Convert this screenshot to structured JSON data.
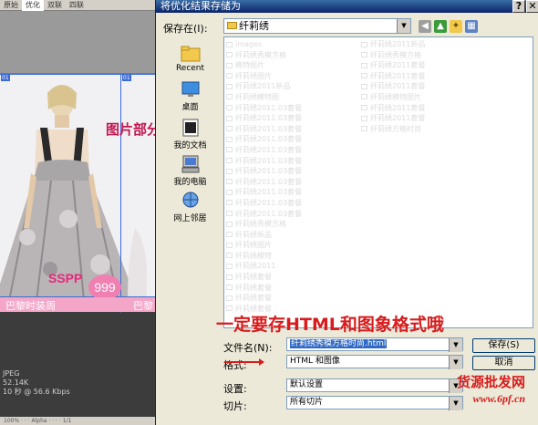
{
  "background_editor": {
    "tabs": [
      "原始",
      "优化",
      "双联",
      "四联"
    ],
    "slice_tags": [
      "01",
      "01"
    ],
    "promo_text": "图片部分",
    "brand": "SSPP",
    "badge": "999",
    "bar_text_left": "巴黎时装周",
    "bar_text_right": "巴黎",
    "status": [
      "JPEG",
      "52.14K",
      "10 秒 @ 56.6 Kbps"
    ],
    "bottom_bar": "100%  ·  ·  ·  Alpha  ·  ·  ·  ·  1/1"
  },
  "dialog": {
    "title": "将优化结果存储为",
    "title_buttons": [
      "?",
      "✕"
    ],
    "save_in_label": "保存在(I):",
    "current_folder": "纤莉绣",
    "places": [
      {
        "label": "Recent",
        "icon": "recent-folder-icon"
      },
      {
        "label": "桌面",
        "icon": "desktop-icon"
      },
      {
        "label": "我的文档",
        "icon": "my-documents-icon"
      },
      {
        "label": "我的电脑",
        "icon": "my-computer-icon"
      },
      {
        "label": "网上邻居",
        "icon": "network-places-icon"
      }
    ],
    "overlay_note": "一定要存HTML和图象格式哦",
    "filename_label": "文件名(N):",
    "filename_value": "纤莉绣秀模方格时尚.html",
    "format_label": "格式:",
    "format_value": "HTML 和图像",
    "settings_label": "设置:",
    "settings_value": "默认设置",
    "slices_label": "切片:",
    "slices_value": "所有切片",
    "save_button": "保存(S)",
    "cancel_button": "取消"
  },
  "watermark": {
    "line1": "货源批发网",
    "line2": "www.6pf.cn"
  },
  "colors": {
    "accent_red": "#d81c1c",
    "title_blue": "#0a246a",
    "pink": "#f4a6c9"
  }
}
